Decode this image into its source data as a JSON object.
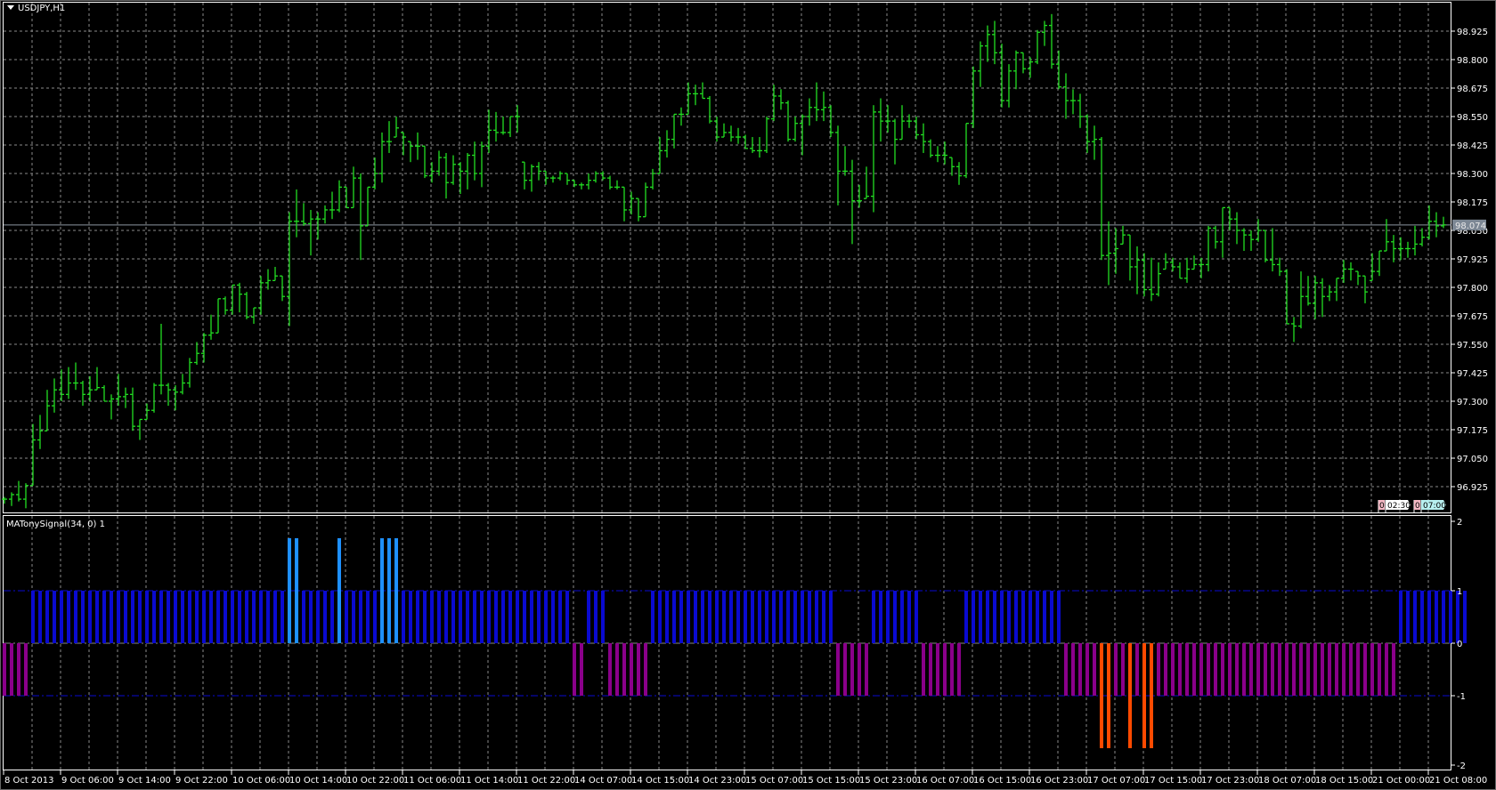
{
  "window": {
    "title": "USDJPY,H1"
  },
  "indicator": {
    "label": "MATonySignal(34, 0) 1"
  },
  "price_axis": {
    "labels": [
      "98.925",
      "98.800",
      "98.675",
      "98.550",
      "98.425",
      "98.300",
      "98.175",
      "98.050",
      "97.925",
      "97.800",
      "97.675",
      "97.550",
      "97.425",
      "97.300",
      "97.175",
      "97.050",
      "96.925"
    ],
    "current_price": "98.074"
  },
  "indicator_axis": {
    "labels": [
      "2",
      "1",
      "0",
      "-1",
      "-2"
    ]
  },
  "time_axis": {
    "labels": [
      "8 Oct 2013",
      "9 Oct 06:00",
      "9 Oct 14:00",
      "9 Oct 22:00",
      "10 Oct 06:00",
      "10 Oct 14:00",
      "10 Oct 22:00",
      "11 Oct 06:00",
      "11 Oct 14:00",
      "11 Oct 22:00",
      "14 Oct 07:00",
      "14 Oct 15:00",
      "14 Oct 23:00",
      "15 Oct 07:00",
      "15 Oct 15:00",
      "15 Oct 23:00",
      "16 Oct 07:00",
      "16 Oct 15:00",
      "16 Oct 23:00",
      "17 Oct 07:00",
      "17 Oct 15:00",
      "17 Oct 23:00",
      "18 Oct 07:00",
      "18 Oct 15:00",
      "21 Oct 00:00",
      "21 Oct 08:00"
    ]
  },
  "time_boxes": [
    {
      "count": "0",
      "time": "02:30",
      "color": "#ffffff"
    },
    {
      "count": "0",
      "time": "07:00",
      "color": "#b8f0f0"
    }
  ],
  "colors": {
    "bars": "#22dd22",
    "grid": "#8a8a8a",
    "up": "#0a0ad0",
    "strong_up": "#1e90ff",
    "down": "#8a008a",
    "strong_down": "#ff4a00",
    "current_line": "#8c96a0"
  },
  "chart_data": [
    {
      "type": "bar",
      "style": "ohlc",
      "title": "USDJPY,H1",
      "ylim": [
        96.925,
        98.925
      ],
      "bar_format": [
        "high",
        "low",
        "close"
      ],
      "bars": [
        [
          96.88,
          96.85,
          96.87
        ],
        [
          96.9,
          96.84,
          96.89
        ],
        [
          96.95,
          96.86,
          96.87
        ],
        [
          96.94,
          96.83,
          96.93
        ],
        [
          97.2,
          96.93,
          97.13
        ],
        [
          97.24,
          97.09,
          97.17
        ],
        [
          97.35,
          97.17,
          97.28
        ],
        [
          97.4,
          97.25,
          97.35
        ],
        [
          97.44,
          97.3,
          97.33
        ],
        [
          97.45,
          97.31,
          97.38
        ],
        [
          97.47,
          97.35,
          97.38
        ],
        [
          97.39,
          97.28,
          97.33
        ],
        [
          97.41,
          97.3,
          97.35
        ],
        [
          97.45,
          97.35,
          97.36
        ],
        [
          97.37,
          97.3,
          97.3
        ],
        [
          97.33,
          97.22,
          97.31
        ],
        [
          97.42,
          97.28,
          97.32
        ],
        [
          97.36,
          97.27,
          97.33
        ],
        [
          97.36,
          97.17,
          97.19
        ],
        [
          97.22,
          97.13,
          97.22
        ],
        [
          97.29,
          97.22,
          97.26
        ],
        [
          97.38,
          97.25,
          97.37
        ],
        [
          97.64,
          97.33,
          97.37
        ],
        [
          97.38,
          97.28,
          97.35
        ],
        [
          97.37,
          97.26,
          97.34
        ],
        [
          97.42,
          97.33,
          97.38
        ],
        [
          97.49,
          97.36,
          97.47
        ],
        [
          97.56,
          97.46,
          97.51
        ],
        [
          97.6,
          97.47,
          97.59
        ],
        [
          97.68,
          97.57,
          97.6
        ],
        [
          97.75,
          97.6,
          97.75
        ],
        [
          97.76,
          97.68,
          97.7
        ],
        [
          97.81,
          97.68,
          97.81
        ],
        [
          97.82,
          97.69,
          97.77
        ],
        [
          97.78,
          97.66,
          97.67
        ],
        [
          97.71,
          97.64,
          97.71
        ],
        [
          97.85,
          97.68,
          97.82
        ],
        [
          97.88,
          97.79,
          97.83
        ],
        [
          97.89,
          97.83,
          97.85
        ],
        [
          97.85,
          97.74,
          97.76
        ],
        [
          98.13,
          97.63,
          98.09
        ],
        [
          98.23,
          98.02,
          98.09
        ],
        [
          98.17,
          98.07,
          98.08
        ],
        [
          98.14,
          97.94,
          98.1
        ],
        [
          98.13,
          98.01,
          98.1
        ],
        [
          98.16,
          98.08,
          98.14
        ],
        [
          98.22,
          98.1,
          98.14
        ],
        [
          98.27,
          98.13,
          98.24
        ],
        [
          98.24,
          98.15,
          98.15
        ],
        [
          98.33,
          98.15,
          98.28
        ],
        [
          98.3,
          97.92,
          98.07
        ],
        [
          98.24,
          98.07,
          98.24
        ],
        [
          98.37,
          98.23,
          98.3
        ],
        [
          98.48,
          98.26,
          98.44
        ],
        [
          98.53,
          98.39,
          98.44
        ],
        [
          98.55,
          98.46,
          98.5
        ],
        [
          98.48,
          98.38,
          98.46
        ],
        [
          98.44,
          98.35,
          98.42
        ],
        [
          98.48,
          98.36,
          98.42
        ],
        [
          98.42,
          98.28,
          98.29
        ],
        [
          98.35,
          98.26,
          98.31
        ],
        [
          98.4,
          98.29,
          98.37
        ],
        [
          98.39,
          98.19,
          98.26
        ],
        [
          98.38,
          98.25,
          98.34
        ],
        [
          98.35,
          98.21,
          98.31
        ],
        [
          98.39,
          98.23,
          98.38
        ],
        [
          98.44,
          98.27,
          98.3
        ],
        [
          98.44,
          98.24,
          98.42
        ],
        [
          98.58,
          98.39,
          98.49
        ],
        [
          98.57,
          98.44,
          98.48
        ],
        [
          98.55,
          98.47,
          98.48
        ],
        [
          98.55,
          98.46,
          98.55
        ],
        [
          98.6,
          98.48,
          98.55
        ],
        [
          98.35,
          98.23,
          98.27
        ],
        [
          98.34,
          98.22,
          98.33
        ],
        [
          98.35,
          98.27,
          98.31
        ],
        [
          98.31,
          98.25,
          98.28
        ],
        [
          98.29,
          98.26,
          98.28
        ],
        [
          98.31,
          98.27,
          98.3
        ],
        [
          98.3,
          98.25,
          98.27
        ],
        [
          98.27,
          98.24,
          98.25
        ],
        [
          98.26,
          98.23,
          98.25
        ],
        [
          98.3,
          98.23,
          98.27
        ],
        [
          98.31,
          98.26,
          98.3
        ],
        [
          98.31,
          98.27,
          98.28
        ],
        [
          98.29,
          98.23,
          98.24
        ],
        [
          98.27,
          98.23,
          98.24
        ],
        [
          98.24,
          98.09,
          98.14
        ],
        [
          98.22,
          98.12,
          98.19
        ],
        [
          98.19,
          98.09,
          98.11
        ],
        [
          98.26,
          98.11,
          98.24
        ],
        [
          98.32,
          98.23,
          98.3
        ],
        [
          98.46,
          98.3,
          98.4
        ],
        [
          98.49,
          98.37,
          98.45
        ],
        [
          98.56,
          98.41,
          98.56
        ],
        [
          98.59,
          98.51,
          98.56
        ],
        [
          98.7,
          98.56,
          98.65
        ],
        [
          98.69,
          98.6,
          98.65
        ],
        [
          98.7,
          98.63,
          98.63
        ],
        [
          98.64,
          98.52,
          98.53
        ],
        [
          98.55,
          98.44,
          98.46
        ],
        [
          98.52,
          98.46,
          98.48
        ],
        [
          98.51,
          98.44,
          98.46
        ],
        [
          98.5,
          98.43,
          98.46
        ],
        [
          98.47,
          98.41,
          98.41
        ],
        [
          98.46,
          98.39,
          98.4
        ],
        [
          98.46,
          98.37,
          98.4
        ],
        [
          98.55,
          98.39,
          98.54
        ],
        [
          98.69,
          98.53,
          98.64
        ],
        [
          98.67,
          98.58,
          98.61
        ],
        [
          98.62,
          98.44,
          98.45
        ],
        [
          98.55,
          98.44,
          98.52
        ],
        [
          98.56,
          98.38,
          98.55
        ],
        [
          98.63,
          98.51,
          98.59
        ],
        [
          98.7,
          98.53,
          98.58
        ],
        [
          98.66,
          98.53,
          98.59
        ],
        [
          98.6,
          98.46,
          98.48
        ],
        [
          98.51,
          98.16,
          98.31
        ],
        [
          98.42,
          98.29,
          98.31
        ],
        [
          98.36,
          97.99,
          98.18
        ],
        [
          98.25,
          98.15,
          98.18
        ],
        [
          98.33,
          98.19,
          98.2
        ],
        [
          98.6,
          98.13,
          98.57
        ],
        [
          98.63,
          98.44,
          98.53
        ],
        [
          98.6,
          98.48,
          98.53
        ],
        [
          98.54,
          98.34,
          98.45
        ],
        [
          98.6,
          98.45,
          98.53
        ],
        [
          98.56,
          98.5,
          98.53
        ],
        [
          98.55,
          98.45,
          98.47
        ],
        [
          98.52,
          98.39,
          98.44
        ],
        [
          98.45,
          98.37,
          98.38
        ],
        [
          98.42,
          98.35,
          98.38
        ],
        [
          98.44,
          98.34,
          98.38
        ],
        [
          98.37,
          98.29,
          98.33
        ],
        [
          98.35,
          98.25,
          98.29
        ],
        [
          98.52,
          98.28,
          98.52
        ],
        [
          98.77,
          98.5,
          98.75
        ],
        [
          98.88,
          98.68,
          98.86
        ],
        [
          98.95,
          98.79,
          98.91
        ],
        [
          98.97,
          98.78,
          98.83
        ],
        [
          98.87,
          98.59,
          98.62
        ],
        [
          98.78,
          98.59,
          98.75
        ],
        [
          98.84,
          98.67,
          98.83
        ],
        [
          98.83,
          98.74,
          98.76
        ],
        [
          98.81,
          98.72,
          98.79
        ],
        [
          98.93,
          98.78,
          98.92
        ],
        [
          98.97,
          98.86,
          98.95
        ],
        [
          99.0,
          98.76,
          98.78
        ],
        [
          98.84,
          98.67,
          98.68
        ],
        [
          98.74,
          98.54,
          98.62
        ],
        [
          98.67,
          98.56,
          98.62
        ],
        [
          98.65,
          98.5,
          98.55
        ],
        [
          98.56,
          98.39,
          98.44
        ],
        [
          98.51,
          98.36,
          98.45
        ],
        [
          98.46,
          97.92,
          97.94
        ],
        [
          98.09,
          97.81,
          97.95
        ],
        [
          98.06,
          97.86,
          97.97
        ],
        [
          98.07,
          97.99,
          98.03
        ],
        [
          98.03,
          97.83,
          97.89
        ],
        [
          97.98,
          97.77,
          97.92
        ],
        [
          97.95,
          97.76,
          97.79
        ],
        [
          97.93,
          97.74,
          97.77
        ],
        [
          97.91,
          97.76,
          97.86
        ],
        [
          97.95,
          97.88,
          97.91
        ],
        [
          97.93,
          97.87,
          97.89
        ],
        [
          97.91,
          97.84,
          97.84
        ],
        [
          97.93,
          97.82,
          97.88
        ],
        [
          97.94,
          97.88,
          97.9
        ],
        [
          97.93,
          97.84,
          97.9
        ],
        [
          98.07,
          97.87,
          98.06
        ],
        [
          98.07,
          97.97,
          98.0
        ],
        [
          98.15,
          97.93,
          98.15
        ],
        [
          98.15,
          98.05,
          98.1
        ],
        [
          98.13,
          97.99,
          98.05
        ],
        [
          98.06,
          97.96,
          98.03
        ],
        [
          98.05,
          97.96,
          98.01
        ],
        [
          98.1,
          98.0,
          98.05
        ],
        [
          98.05,
          97.91,
          97.92
        ],
        [
          98.06,
          97.87,
          97.9
        ],
        [
          97.93,
          97.85,
          97.87
        ],
        [
          97.88,
          97.64,
          97.64
        ],
        [
          97.67,
          97.56,
          97.63
        ],
        [
          97.87,
          97.62,
          97.76
        ],
        [
          97.85,
          97.72,
          97.73
        ],
        [
          97.85,
          97.66,
          97.82
        ],
        [
          97.84,
          97.67,
          97.76
        ],
        [
          97.81,
          97.74,
          97.78
        ],
        [
          97.84,
          97.74,
          97.84
        ],
        [
          97.92,
          97.82,
          97.88
        ],
        [
          97.91,
          97.83,
          97.88
        ],
        [
          97.87,
          97.81,
          97.85
        ],
        [
          97.85,
          97.73,
          97.78
        ],
        [
          97.95,
          97.83,
          97.87
        ],
        [
          97.96,
          97.85,
          97.96
        ],
        [
          98.1,
          97.96,
          98.0
        ],
        [
          98.03,
          97.91,
          97.97
        ],
        [
          98.02,
          97.92,
          97.97
        ],
        [
          98.0,
          97.93,
          97.97
        ],
        [
          98.07,
          97.94,
          97.99
        ],
        [
          98.06,
          97.98,
          98.02
        ],
        [
          98.16,
          98.01,
          98.09
        ],
        [
          98.13,
          98.02,
          98.07
        ],
        [
          98.11,
          98.06,
          98.074
        ]
      ]
    },
    {
      "type": "bar",
      "title": "MATonySignal(34, 0) 1",
      "ylim": [
        -2,
        2
      ],
      "levels": [
        1,
        0,
        -1
      ],
      "values": [
        -1,
        -1,
        -1,
        -1,
        1,
        1,
        1,
        1,
        1,
        1,
        1,
        1,
        1,
        1,
        1,
        1,
        1,
        1,
        1,
        1,
        1,
        1,
        1,
        1,
        1,
        1,
        1,
        1,
        1,
        1,
        1,
        1,
        1,
        1,
        1,
        1,
        1,
        1,
        1,
        1,
        2,
        2,
        1,
        1,
        1,
        1,
        1,
        2,
        1,
        1,
        1,
        1,
        1,
        2,
        2,
        2,
        1,
        1,
        1,
        1,
        1,
        1,
        1,
        1,
        1,
        1,
        1,
        1,
        1,
        1,
        1,
        1,
        1,
        1,
        1,
        1,
        1,
        1,
        1,
        1,
        -1,
        -1,
        1,
        1,
        1,
        -1,
        -1,
        -1,
        -1,
        -1,
        -1,
        1,
        1,
        1,
        1,
        1,
        1,
        1,
        1,
        1,
        1,
        1,
        1,
        1,
        1,
        1,
        1,
        1,
        1,
        1,
        1,
        1,
        1,
        1,
        1,
        1,
        1,
        -1,
        -1,
        -1,
        -1,
        -1,
        1,
        1,
        1,
        1,
        1,
        1,
        1,
        -1,
        -1,
        -1,
        -1,
        -1,
        -1,
        1,
        1,
        1,
        1,
        1,
        1,
        1,
        1,
        1,
        1,
        1,
        1,
        1,
        1,
        -1,
        -1,
        -1,
        -1,
        -1,
        -2,
        -2,
        -1,
        -1,
        -2,
        -1,
        -2,
        -2,
        -1,
        -1,
        -1,
        -1,
        -1,
        -1,
        -1,
        -1,
        -1,
        -1,
        -1,
        -1,
        -1,
        -1,
        -1,
        -1,
        -1,
        -1,
        -1,
        -1,
        -1,
        -1,
        -1,
        -1,
        -1,
        -1,
        -1,
        -1,
        -1,
        -1,
        -1,
        -1,
        -1,
        -1,
        1,
        1,
        1,
        1,
        1,
        1,
        1,
        1,
        1,
        1
      ]
    }
  ]
}
